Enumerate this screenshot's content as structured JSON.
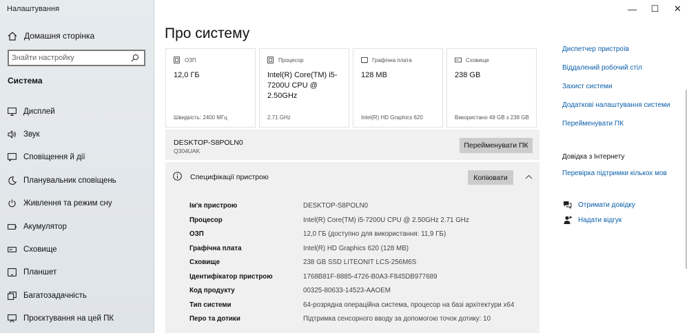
{
  "app": {
    "title": "Налаштування"
  },
  "sidebar": {
    "home": {
      "label": "Домашня сторінка",
      "icon": "home-icon"
    },
    "search": {
      "placeholder": "Знайти настройку",
      "icon": "search-icon"
    },
    "section": "Система",
    "items": [
      {
        "label": "Дисплей",
        "icon": "monitor-icon"
      },
      {
        "label": "Звук",
        "icon": "speaker-icon"
      },
      {
        "label": "Сповіщення й дії",
        "icon": "notification-icon"
      },
      {
        "label": "Планувальник сповіщень",
        "icon": "moon-icon"
      },
      {
        "label": "Живлення та режим сну",
        "icon": "power-icon"
      },
      {
        "label": "Акумулятор",
        "icon": "battery-icon"
      },
      {
        "label": "Сховище",
        "icon": "storage-icon"
      },
      {
        "label": "Планшет",
        "icon": "tablet-icon"
      },
      {
        "label": "Багатозадачність",
        "icon": "multitasking-icon"
      },
      {
        "label": "Проєктування на цей ПК",
        "icon": "projecting-icon"
      }
    ]
  },
  "window": {
    "minimize": "—",
    "maximize": "☐",
    "close": "✕"
  },
  "page": {
    "title": "Про систему"
  },
  "cards": [
    {
      "title": "ОЗП",
      "icon": "ram-icon",
      "value": "12,0 ГБ",
      "sub": "Швидкість: 2400 МГц"
    },
    {
      "title": "Процесор",
      "icon": "cpu-icon",
      "value": "Intel(R) Core(TM) i5-7200U CPU @ 2.50GHz",
      "sub": "2.71 GHz"
    },
    {
      "title": "Графічна плата",
      "icon": "gpu-icon",
      "value": "128 MB",
      "sub": "Intel(R) HD Graphics 620"
    },
    {
      "title": "Сховище",
      "icon": "storage-icon",
      "value": "238 GB",
      "sub": "Використано 49 GB з 238 GB"
    }
  ],
  "pc": {
    "name": "DESKTOP-S8POLN0",
    "model": "Q304UAK",
    "rename_label": "Перейменувати ПК"
  },
  "specs": {
    "title": "Специфікації пристрою",
    "copy_label": "Копіювати",
    "rows": [
      {
        "key": "Ім'я пристрою",
        "value": "DESKTOP-S8POLN0"
      },
      {
        "key": "Процесор",
        "value": "Intel(R) Core(TM) i5-7200U CPU @ 2.50GHz   2.71 GHz"
      },
      {
        "key": "ОЗП",
        "value": "12,0 ГБ (доступно для використання: 11,9 ГБ)"
      },
      {
        "key": "Графічна плата",
        "value": "Intel(R) HD Graphics 620 (128 MB)"
      },
      {
        "key": "Сховище",
        "value": "238 GB SSD LITEONIT LCS-256M6S"
      },
      {
        "key": "Ідентифікатор пристрою",
        "value": "1768B81F-8885-4726-B0A3-F845DB977689"
      },
      {
        "key": "Код продукту",
        "value": "00325-80633-14523-AAOEM"
      },
      {
        "key": "Тип системи",
        "value": "64-розрядна операційна система, процесор на базі архітектури x64"
      },
      {
        "key": "Перо та дотики",
        "value": "Підтримка сенсорного вводу за допомогою точок дотику: 10"
      }
    ]
  },
  "related": {
    "links": [
      "Диспетчер пристроїв",
      "Віддалений робочий стіл",
      "Захист системи",
      "Додаткові налаштування системи",
      "Перейменувати ПК"
    ],
    "web_help_title": "Довідка з Інтернету",
    "web_help_link": "Перевірка підтримки кількох мов",
    "get_help": "Отримати довідку",
    "feedback": "Надати відгук"
  }
}
